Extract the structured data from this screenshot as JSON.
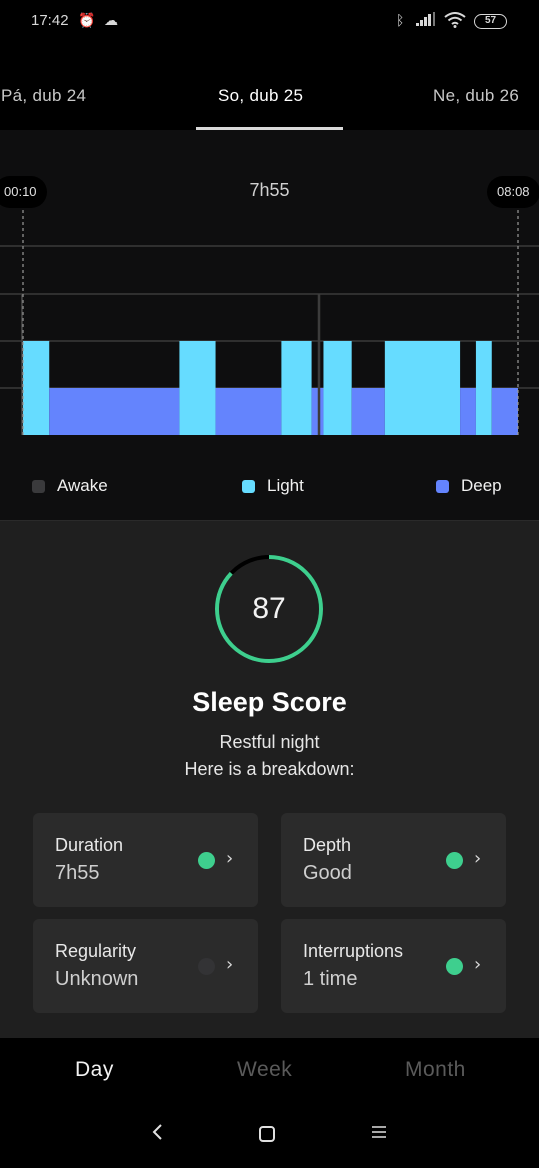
{
  "status_bar": {
    "time": "17:42",
    "left_icons": [
      "alarm-icon",
      "cloud-icon"
    ],
    "right_icons": [
      "bluetooth-icon",
      "signal-icon",
      "wifi-icon"
    ],
    "battery": "57"
  },
  "date_tabs": [
    {
      "label": "Pá, dub 24",
      "active": false
    },
    {
      "label": "So, dub 25",
      "active": true
    },
    {
      "label": "Ne, dub 26",
      "active": false
    }
  ],
  "chart": {
    "start_time": "00:10",
    "end_time": "08:08",
    "total_duration": "7h55",
    "legend": [
      {
        "label": "Awake",
        "color": "#3a3a3c"
      },
      {
        "label": "Light",
        "color": "#66dcff"
      },
      {
        "label": "Deep",
        "color": "#6484fd"
      }
    ]
  },
  "chart_data": {
    "type": "hypnogram",
    "title": "7h55",
    "x_range": [
      "00:10",
      "08:08"
    ],
    "x_unit": "fraction of night (0 = 00:10, 1 = 08:08)",
    "stages": [
      "Deep",
      "Light",
      "Awake"
    ],
    "midnight_marker_fraction": 0.6,
    "segments": [
      {
        "stage": "Light",
        "start": 0.0,
        "end": 0.053
      },
      {
        "stage": "Deep",
        "start": 0.053,
        "end": 0.316
      },
      {
        "stage": "Light",
        "start": 0.316,
        "end": 0.389
      },
      {
        "stage": "Deep",
        "start": 0.389,
        "end": 0.522
      },
      {
        "stage": "Light",
        "start": 0.522,
        "end": 0.583
      },
      {
        "stage": "Deep",
        "start": 0.583,
        "end": 0.607
      },
      {
        "stage": "Light",
        "start": 0.607,
        "end": 0.664
      },
      {
        "stage": "Deep",
        "start": 0.664,
        "end": 0.731
      },
      {
        "stage": "Light",
        "start": 0.731,
        "end": 0.883
      },
      {
        "stage": "Deep",
        "start": 0.883,
        "end": 0.915
      },
      {
        "stage": "Light",
        "start": 0.915,
        "end": 0.947
      },
      {
        "stage": "Deep",
        "start": 0.947,
        "end": 1.0
      }
    ],
    "legend": [
      "Awake",
      "Light",
      "Deep"
    ],
    "legend_position": "bottom",
    "grid": true
  },
  "score": {
    "value": "87",
    "percent": 87,
    "title": "Sleep Score",
    "subtitle_line1": "Restful night",
    "subtitle_line2": "Here is a breakdown:",
    "ring_color": "#3ecf8e",
    "ring_track_color": "#000000"
  },
  "metrics": [
    {
      "name": "Duration",
      "value": "7h55",
      "status_color": "#3ecf8e"
    },
    {
      "name": "Depth",
      "value": "Good",
      "status_color": "#3ecf8e"
    },
    {
      "name": "Regularity",
      "value": "Unknown",
      "status_color": "#333335"
    },
    {
      "name": "Interruptions",
      "value": "1 time",
      "status_color": "#3ecf8e"
    }
  ],
  "bottom_tabs": [
    {
      "label": "Day",
      "active": true
    },
    {
      "label": "Week",
      "active": false
    },
    {
      "label": "Month",
      "active": false
    }
  ],
  "nav": {
    "back": "back-icon",
    "home": "home-icon",
    "menu": "menu-icon"
  }
}
